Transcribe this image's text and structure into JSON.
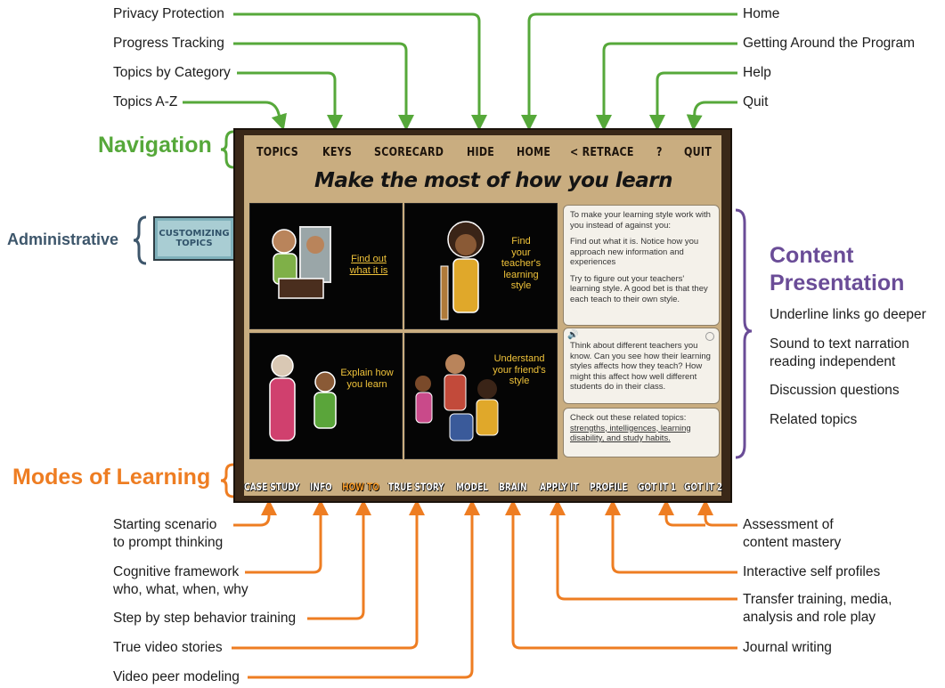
{
  "top_left_labels": [
    "Privacy Protection",
    "Progress Tracking",
    "Topics by Category",
    "Topics A-Z"
  ],
  "top_right_labels": [
    "Home",
    "Getting Around the Program",
    "Help",
    "Quit"
  ],
  "categories": {
    "navigation": "Navigation",
    "administrative": "Administrative",
    "content": "Content\nPresentation",
    "modes": "Modes of Learning"
  },
  "content_features": [
    "Underline links go deeper",
    "Sound to text narration\nreading independent",
    "Discussion questions",
    "Related topics"
  ],
  "bottom_left_labels": [
    "Starting scenario\nto prompt thinking",
    "Cognitive framework\nwho, what, when, why",
    "Step by step behavior training",
    "True video stories",
    "Video peer modeling"
  ],
  "bottom_right_labels": [
    "Assessment of\ncontent mastery",
    "Interactive self profiles",
    "Transfer training, media,\nanalysis and role play",
    "Journal writing"
  ],
  "screen": {
    "nav": [
      "TOPICS",
      "KEYS",
      "SCORECARD",
      "HIDE",
      "HOME",
      "< RETRACE",
      "?",
      "QUIT"
    ],
    "admin_button": "CUSTOMIZING\nTOPICS",
    "heading": "Make the most of how you learn",
    "tiles": {
      "t1": "Find out\nwhat it is",
      "t2": "Find\nyour\nteacher's\nlearning\nstyle",
      "t3": "Explain how\nyou learn",
      "t4": "Understand\nyour friend's\nstyle"
    },
    "panel1": {
      "p1": "To make your learning style work with you instead of against you:",
      "p2": "Find out what it is. Notice how you approach new information and experiences",
      "p3": "Try to figure out your teachers' learning style. A good bet is that they each teach to their own style."
    },
    "panel2": "Think about different teachers you know. Can you see how their learning styles affects how they teach? How might this affect how well different students do in their class.",
    "panel3_intro": "Check out these related topics:",
    "panel3_links": "strengths, intelligences, learning disability, and study habits.",
    "modes": [
      "CASE STUDY",
      "INFO",
      "HOW TO",
      "TRUE STORY",
      "MODEL",
      "BRAIN",
      "APPLY IT",
      "PROFILE",
      "GOT IT 1",
      "GOT IT 2"
    ]
  },
  "colors": {
    "navigation": "#56a83a",
    "administrative": "#3d566b",
    "content": "#6a4c97",
    "modes": "#ee7d22",
    "tile_text": "#f0c33a",
    "active_mode": "#f39a2b"
  }
}
